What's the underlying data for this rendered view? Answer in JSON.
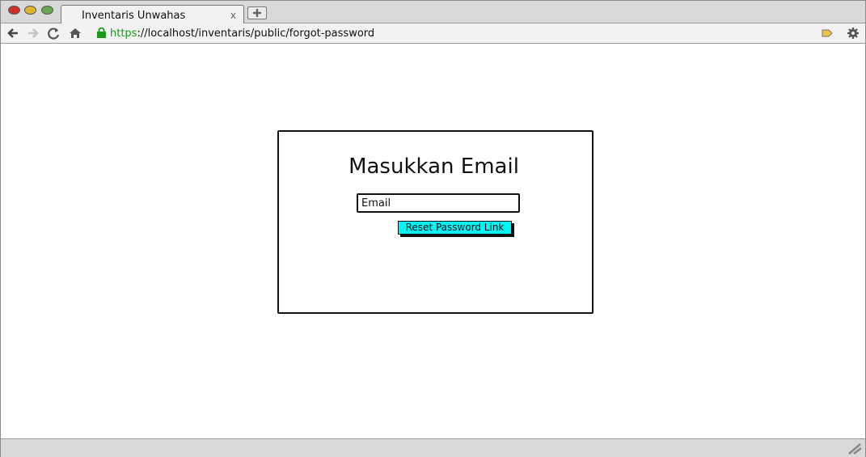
{
  "browser": {
    "tab_title": "Inventaris Unwahas",
    "tab_close": "x",
    "url_protocol": "https",
    "url_rest": "://localhost/inventaris/public/forgot-password"
  },
  "form": {
    "heading": "Masukkan Email",
    "email_placeholder": "Email",
    "reset_button": "Reset Password Link"
  },
  "colors": {
    "accent_button": "#00f5f5",
    "secure_protocol": "#1a9a1a"
  }
}
